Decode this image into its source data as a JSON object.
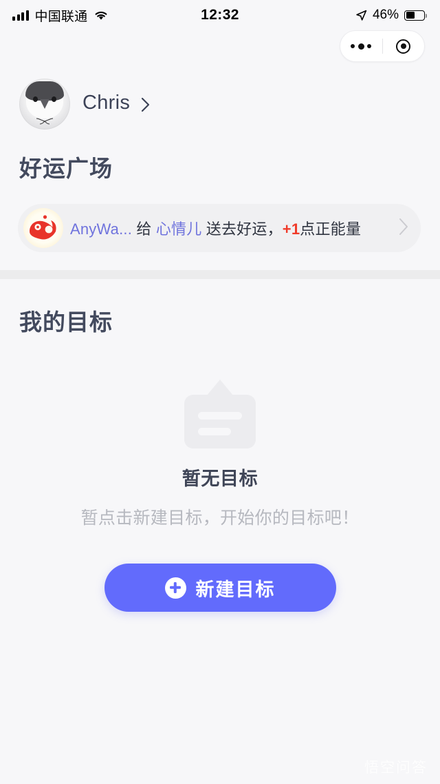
{
  "status_bar": {
    "carrier": "中国联通",
    "time": "12:32",
    "battery_percent": "46%",
    "signal_icon": "signal-bars-icon",
    "wifi_icon": "wifi-icon",
    "location_icon": "location-arrow-icon",
    "battery_icon": "battery-icon",
    "battery_level": 52
  },
  "capsule": {
    "menu_icon": "more-dots-icon",
    "target_icon": "target-circle-icon"
  },
  "profile": {
    "avatar_icon": "penguin-avatar",
    "username": "Chris",
    "chevron_icon": "chevron-right-icon"
  },
  "plaza": {
    "heading": "好运广场",
    "banner": {
      "avatar_icon": "koi-fish-avatar",
      "sender": "AnyWa...",
      "verb": "给",
      "receiver": "心情儿",
      "action": "送去好运，",
      "bonus": "+1",
      "bonus_suffix": "点正能量",
      "chevron_icon": "chevron-right-icon"
    }
  },
  "goals": {
    "heading": "我的目标",
    "empty": {
      "illustration_icon": "clipboard-empty-icon",
      "title": "暂无目标",
      "subtitle": "暂点击新建目标，开始你的目标吧！"
    },
    "cta": {
      "icon": "plus-circle-icon",
      "label": "新建目标"
    }
  },
  "watermark": "悟空问答",
  "colors": {
    "page_bg": "#f7f7f9",
    "heading": "#434a5e",
    "accent_purple": "#6f73dd",
    "accent_red": "#f03b2a",
    "cta_bg": "#626bfc",
    "banner_bg": "#f0f0f2",
    "muted_text": "#b6b8bf",
    "band": "#ececed"
  }
}
